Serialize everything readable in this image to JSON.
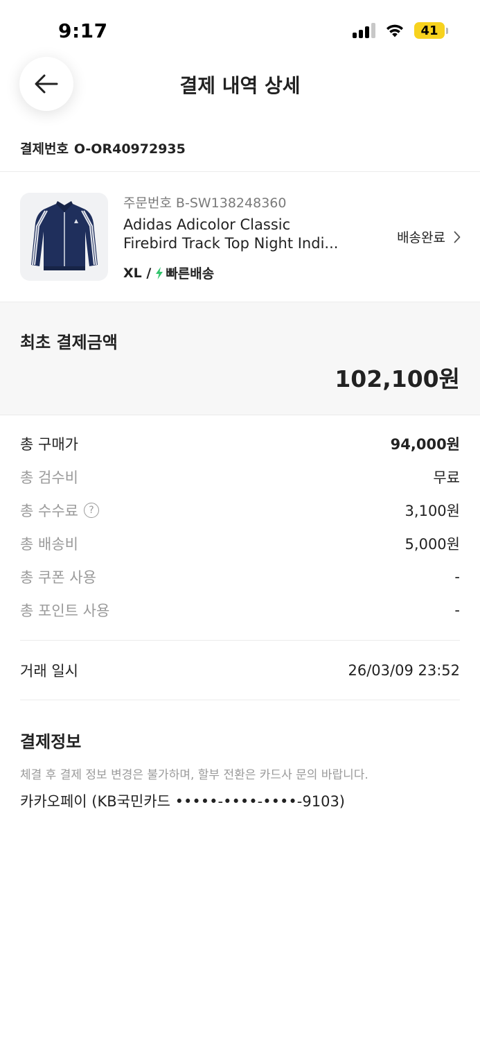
{
  "status_bar": {
    "time": "9:17",
    "battery": "41"
  },
  "header": {
    "title": "결제 내역 상세"
  },
  "payment": {
    "number_label": "결제번호",
    "number": "O-OR40972935"
  },
  "product": {
    "order_label": "주문번호",
    "order_number": "B-SW138248360",
    "name_line1": "Adidas Adicolor Classic",
    "name_line2": "Firebird Track Top Night Indi...",
    "size": "XL /",
    "shipping_type": "빠른배송",
    "delivery_status": "배송완료"
  },
  "initial_payment": {
    "label": "최초 결제금액",
    "amount": "102,100원"
  },
  "price_breakdown": [
    {
      "label": "총 구매가",
      "value": "94,000원"
    },
    {
      "label": "총 검수비",
      "value": "무료"
    },
    {
      "label": "총 수수료",
      "value": "3,100원"
    },
    {
      "label": "총 배송비",
      "value": "5,000원"
    },
    {
      "label": "총 쿠폰 사용",
      "value": "-"
    },
    {
      "label": "총 포인트 사용",
      "value": "-"
    }
  ],
  "transaction": {
    "label": "거래 일시",
    "datetime": "26/03/09 23:52"
  },
  "payment_info": {
    "title": "결제정보",
    "notice": "체결 후 결제 정보 변경은 불가하며, 할부 전환은 카드사 문의 바랍니다.",
    "method": "카카오페이 (KB국민카드 •••••-••••-••••-9103)"
  },
  "colors": {
    "accent_green": "#31c46c",
    "battery_yellow": "#f7d21e",
    "product_navy": "#1f2f5c"
  },
  "icons": [
    "back-arrow-icon",
    "chevron-right-icon",
    "lightning-icon",
    "help-icon",
    "signal-icon",
    "wifi-icon",
    "battery-icon"
  ]
}
